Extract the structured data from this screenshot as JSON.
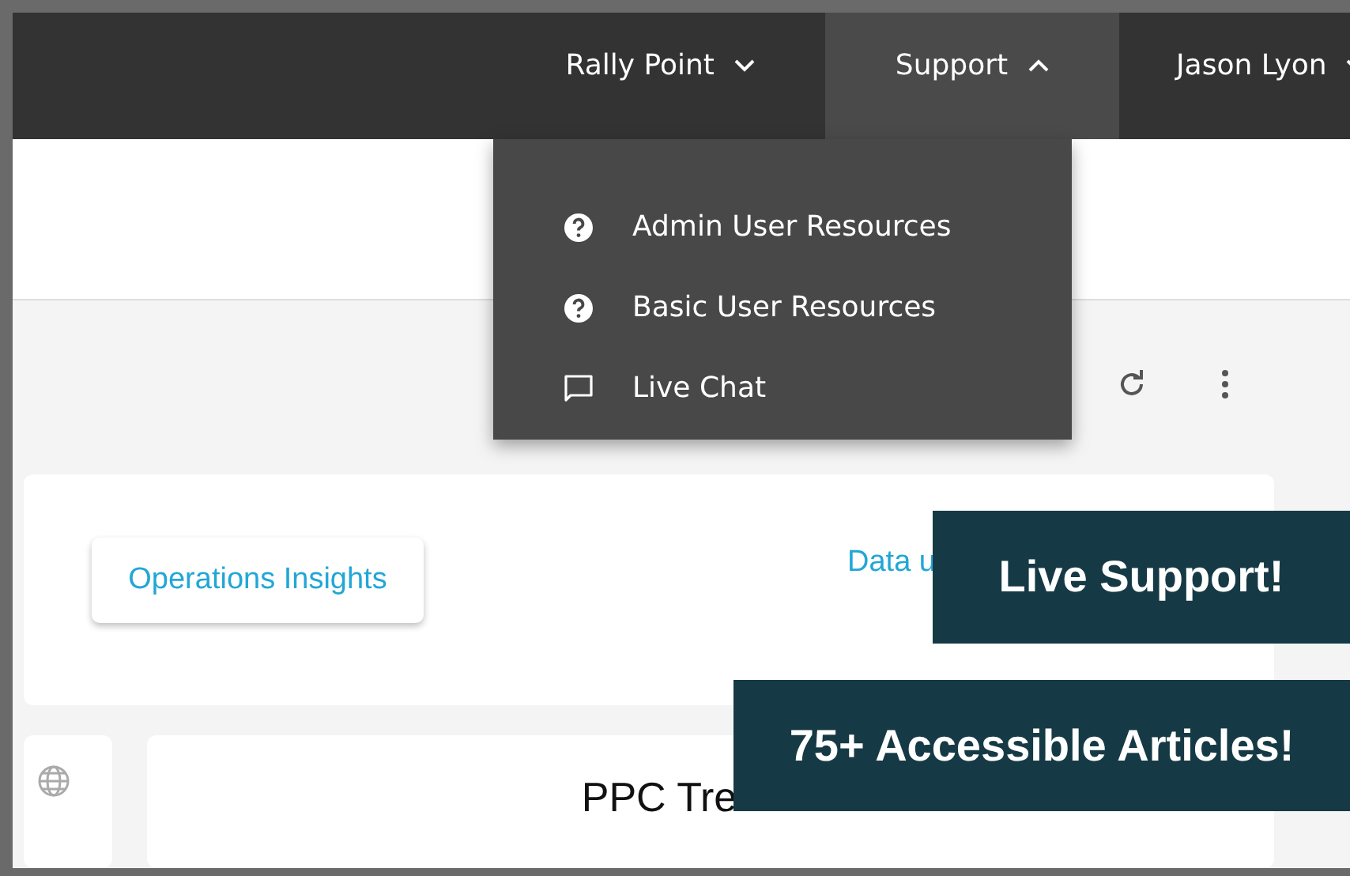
{
  "nav": {
    "items": [
      {
        "label": "Rally Point",
        "expanded": false,
        "selected": false
      },
      {
        "label": "Support",
        "expanded": true,
        "selected": true
      },
      {
        "label": "Jason Lyon",
        "expanded": false,
        "selected": false
      }
    ]
  },
  "support_menu": {
    "items": [
      {
        "label": "Admin User Resources",
        "kind": "help"
      },
      {
        "label": "Basic User Resources",
        "kind": "help"
      },
      {
        "label": "Live Chat",
        "kind": "chat"
      }
    ]
  },
  "dashboard": {
    "insights_button": "Operations Insights",
    "data_link": "Data u",
    "chart_title": "PPC Tre"
  },
  "callouts": [
    "Live Support!",
    "75+ Accessible Articles!"
  ]
}
